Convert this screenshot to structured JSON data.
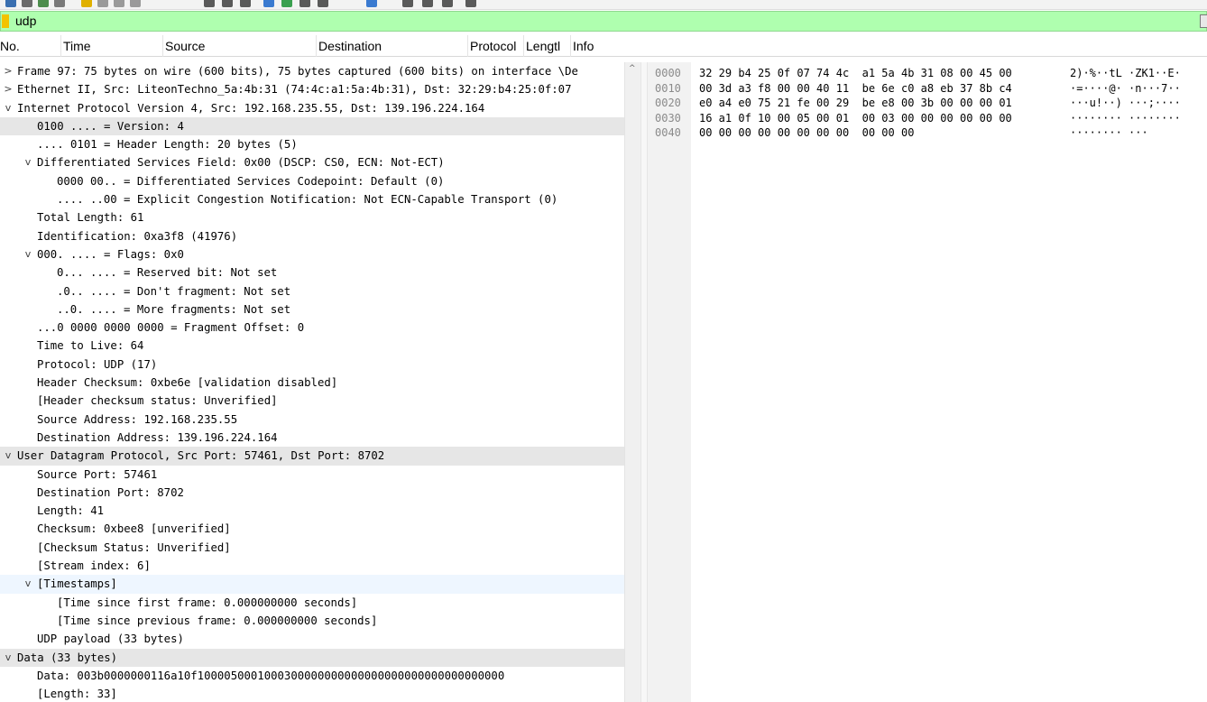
{
  "filter": {
    "value": "udp"
  },
  "columns": [
    {
      "label": "No."
    },
    {
      "label": "Time"
    },
    {
      "label": "Source"
    },
    {
      "label": "Destination"
    },
    {
      "label": "Protocol"
    },
    {
      "label": "Lengtl"
    },
    {
      "label": "Info"
    }
  ],
  "tree": [
    {
      "level": 0,
      "toggle": ">",
      "text": "Frame 97: 75 bytes on wire (600 bits), 75 bytes captured (600 bits) on interface \\De",
      "state": ""
    },
    {
      "level": 0,
      "toggle": ">",
      "text": "Ethernet II, Src: LiteonTechno_5a:4b:31 (74:4c:a1:5a:4b:31), Dst: 32:29:b4:25:0f:07",
      "state": ""
    },
    {
      "level": 0,
      "toggle": "v",
      "text": "Internet Protocol Version 4, Src: 192.168.235.55, Dst: 139.196.224.164",
      "state": ""
    },
    {
      "level": 1,
      "toggle": "",
      "text": "0100 .... = Version: 4",
      "state": "sel"
    },
    {
      "level": 1,
      "toggle": "",
      "text": ".... 0101 = Header Length: 20 bytes (5)",
      "state": ""
    },
    {
      "level": 1,
      "toggle": "v",
      "text": "Differentiated Services Field: 0x00 (DSCP: CS0, ECN: Not-ECT)",
      "state": ""
    },
    {
      "level": 2,
      "toggle": "",
      "text": "0000 00.. = Differentiated Services Codepoint: Default (0)",
      "state": ""
    },
    {
      "level": 2,
      "toggle": "",
      "text": ".... ..00 = Explicit Congestion Notification: Not ECN-Capable Transport (0)",
      "state": ""
    },
    {
      "level": 1,
      "toggle": "",
      "text": "Total Length: 61",
      "state": ""
    },
    {
      "level": 1,
      "toggle": "",
      "text": "Identification: 0xa3f8 (41976)",
      "state": ""
    },
    {
      "level": 1,
      "toggle": "v",
      "text": "000. .... = Flags: 0x0",
      "state": ""
    },
    {
      "level": 2,
      "toggle": "",
      "text": "0... .... = Reserved bit: Not set",
      "state": ""
    },
    {
      "level": 2,
      "toggle": "",
      "text": ".0.. .... = Don't fragment: Not set",
      "state": ""
    },
    {
      "level": 2,
      "toggle": "",
      "text": "..0. .... = More fragments: Not set",
      "state": ""
    },
    {
      "level": 1,
      "toggle": "",
      "text": "...0 0000 0000 0000 = Fragment Offset: 0",
      "state": ""
    },
    {
      "level": 1,
      "toggle": "",
      "text": "Time to Live: 64",
      "state": ""
    },
    {
      "level": 1,
      "toggle": "",
      "text": "Protocol: UDP (17)",
      "state": ""
    },
    {
      "level": 1,
      "toggle": "",
      "text": "Header Checksum: 0xbe6e [validation disabled]",
      "state": ""
    },
    {
      "level": 1,
      "toggle": "",
      "text": "[Header checksum status: Unverified]",
      "state": ""
    },
    {
      "level": 1,
      "toggle": "",
      "text": "Source Address: 192.168.235.55",
      "state": ""
    },
    {
      "level": 1,
      "toggle": "",
      "text": "Destination Address: 139.196.224.164",
      "state": ""
    },
    {
      "level": 0,
      "toggle": "v",
      "text": "User Datagram Protocol, Src Port: 57461, Dst Port: 8702",
      "state": "sel"
    },
    {
      "level": 1,
      "toggle": "",
      "text": "Source Port: 57461",
      "state": ""
    },
    {
      "level": 1,
      "toggle": "",
      "text": "Destination Port: 8702",
      "state": ""
    },
    {
      "level": 1,
      "toggle": "",
      "text": "Length: 41",
      "state": ""
    },
    {
      "level": 1,
      "toggle": "",
      "text": "Checksum: 0xbee8 [unverified]",
      "state": ""
    },
    {
      "level": 1,
      "toggle": "",
      "text": "[Checksum Status: Unverified]",
      "state": ""
    },
    {
      "level": 1,
      "toggle": "",
      "text": "[Stream index: 6]",
      "state": ""
    },
    {
      "level": 1,
      "toggle": "v",
      "text": "[Timestamps]",
      "state": "hl"
    },
    {
      "level": 2,
      "toggle": "",
      "text": "[Time since first frame: 0.000000000 seconds]",
      "state": ""
    },
    {
      "level": 2,
      "toggle": "",
      "text": "[Time since previous frame: 0.000000000 seconds]",
      "state": ""
    },
    {
      "level": 1,
      "toggle": "",
      "text": "UDP payload (33 bytes)",
      "state": ""
    },
    {
      "level": 0,
      "toggle": "v",
      "text": "Data (33 bytes)",
      "state": "sel"
    },
    {
      "level": 1,
      "toggle": "",
      "text": "Data: 003b0000000116a10f1000050001000300000000000000000000000000000000",
      "state": ""
    },
    {
      "level": 1,
      "toggle": "",
      "text": "[Length: 33]",
      "state": ""
    }
  ],
  "hex_rows": [
    {
      "offset": "0000",
      "bytes": "32 29 b4 25 0f 07 74 4c  a1 5a 4b 31 08 00 45 00",
      "ascii": "2)·%··tL ·ZK1··E·"
    },
    {
      "offset": "0010",
      "bytes": "00 3d a3 f8 00 00 40 11  be 6e c0 a8 eb 37 8b c4",
      "ascii": "·=····@· ·n···7··"
    },
    {
      "offset": "0020",
      "bytes": "e0 a4 e0 75 21 fe 00 29  be e8 00 3b 00 00 00 01",
      "ascii": "···u!··) ···;····"
    },
    {
      "offset": "0030",
      "bytes": "16 a1 0f 10 00 05 00 01  00 03 00 00 00 00 00 00",
      "ascii": "········ ········"
    },
    {
      "offset": "0040",
      "bytes": "00 00 00 00 00 00 00 00  00 00 00",
      "ascii": "········ ···"
    }
  ],
  "icons": {
    "filter": "bookmark-icon",
    "apply": "apply-filter-icon",
    "expanded": "chevron-down-icon",
    "collapsed": "chevron-right-icon"
  }
}
